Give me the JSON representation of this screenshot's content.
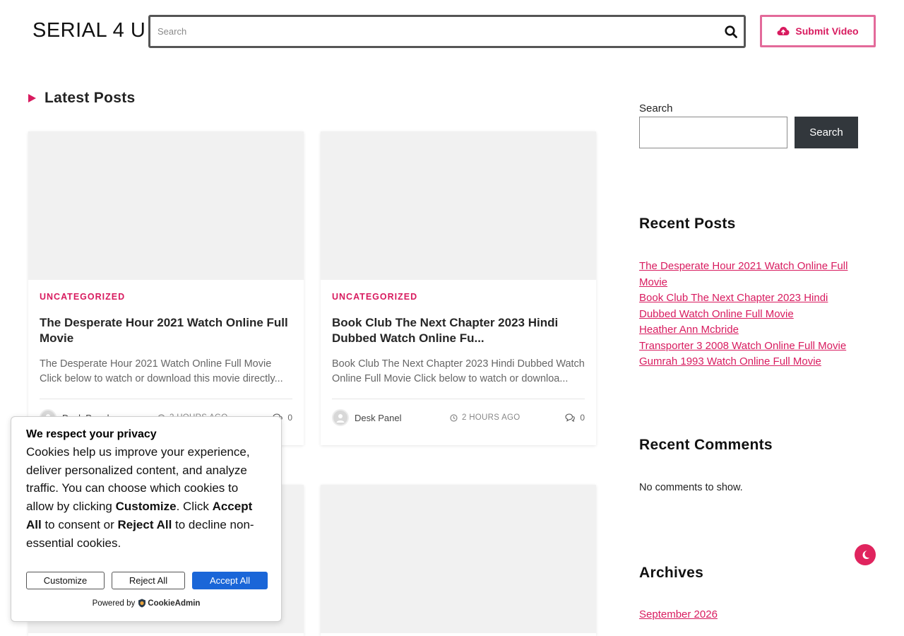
{
  "header": {
    "logo": "SERIAL 4 U",
    "search_placeholder": "Search",
    "submit_label": "Submit Video"
  },
  "main": {
    "section_title": "Latest Posts",
    "posts": [
      {
        "category": "UNCATEGORIZED",
        "title": "The Desperate Hour 2021 Watch Online Full Movie",
        "excerpt": "The Desperate Hour 2021 Watch Online Full Movie Click below to watch or download this movie directly...",
        "author": "Desk Panel",
        "time": "2 HOURS AGO",
        "comments": "0"
      },
      {
        "category": "UNCATEGORIZED",
        "title": "Book Club The Next Chapter 2023 Hindi Dubbed Watch Online Fu...",
        "excerpt": "Book Club The Next Chapter 2023 Hindi Dubbed Watch Online Full Movie Click below to watch or downloa...",
        "author": "Desk Panel",
        "time": "2 HOURS AGO",
        "comments": "0"
      }
    ]
  },
  "sidebar": {
    "search_label": "Search",
    "search_button": "Search",
    "recent_posts_title": "Recent Posts",
    "recent_posts": [
      "The Desperate Hour 2021 Watch Online Full Movie",
      "Book Club The Next Chapter 2023 Hindi Dubbed Watch Online Full Movie",
      "Heather Ann Mcbride",
      "Transporter 3 2008 Watch Online Full Movie",
      "Gumrah 1993 Watch Online Full Movie"
    ],
    "recent_comments_title": "Recent Comments",
    "no_comments": "No comments to show.",
    "archives_title": "Archives",
    "archive_link": "September 2026"
  },
  "cookie": {
    "title": "We respect your privacy",
    "text_1": "Cookies help us improve your experience, deliver personalized content, and analyze traffic. You can choose which cookies to allow by clicking ",
    "bold_customize": "Customize",
    "text_2": ". Click ",
    "bold_accept": "Accept All",
    "text_3": " to consent or ",
    "bold_reject": "Reject All",
    "text_4": " to decline non-essential cookies.",
    "btn_customize": "Customize",
    "btn_reject": "Reject All",
    "btn_accept": "Accept All",
    "powered_by": "Powered by",
    "brand": "CookieAdmin"
  },
  "colors": {
    "accent": "#d81b5f",
    "dark_button": "#32373c",
    "cookie_accept": "#1a66d8"
  }
}
